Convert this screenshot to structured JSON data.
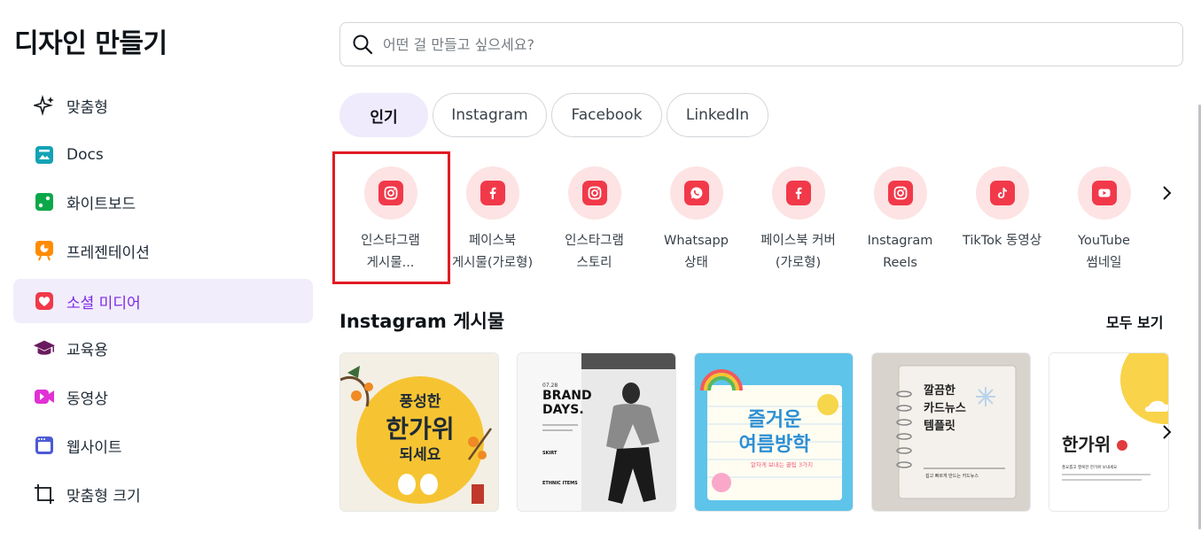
{
  "sidebar": {
    "title": "디자인 만들기",
    "items": [
      {
        "label": "맞춤형"
      },
      {
        "label": "Docs"
      },
      {
        "label": "화이트보드"
      },
      {
        "label": "프레젠테이션"
      },
      {
        "label": "소셜 미디어"
      },
      {
        "label": "교육용"
      },
      {
        "label": "동영상"
      },
      {
        "label": "웹사이트"
      },
      {
        "label": "맞춤형 크기"
      }
    ]
  },
  "search": {
    "placeholder": "어떤 걸 만들고 싶으세요?",
    "value": ""
  },
  "tabs": [
    {
      "label": "인기"
    },
    {
      "label": "Instagram"
    },
    {
      "label": "Facebook"
    },
    {
      "label": "LinkedIn"
    }
  ],
  "categories": [
    {
      "label": "인스타그램\n게시물...",
      "icon": "instagram-icon"
    },
    {
      "label": "페이스북\n게시물(가로형)",
      "icon": "facebook-icon"
    },
    {
      "label": "인스타그램\n스토리",
      "icon": "instagram-icon"
    },
    {
      "label": "Whatsapp\n상태",
      "icon": "whatsapp-icon"
    },
    {
      "label": "페이스북 커버\n(가로형)",
      "icon": "facebook-icon"
    },
    {
      "label": "Instagram\nReels",
      "icon": "instagram-icon"
    },
    {
      "label": "TikTok 동영상",
      "icon": "tiktok-icon"
    },
    {
      "label": "YouTube\n썸네일",
      "icon": "youtube-icon"
    }
  ],
  "section": {
    "title": "Instagram 게시물",
    "see_all": "모두 보기"
  },
  "templates": {
    "t1": {
      "line1": "풍성한",
      "line2": "한가위",
      "line3": "되세요"
    },
    "t2": {
      "title": "BRAND\nDAYS.",
      "date": "07.28",
      "skirt": "SKIRT",
      "ethnic": "ETHNIC ITEMS"
    },
    "t3": {
      "line1": "즐거운",
      "line2": "여름방학",
      "sub": "알차게 보내는 꿀팁 3가지"
    },
    "t4": {
      "line1": "깔끔한",
      "line2": "카드뉴스",
      "line3": "템플릿",
      "footer": "쉽고 빠르게 만드는 카드뉴스"
    },
    "t5": {
      "title": "한가위",
      "body": "풍요롭고 행복한 한가위 보내세요"
    }
  },
  "colors": {
    "accent": "#7d2ae8",
    "brand_red": "#f1394a",
    "highlight": "#e01b24"
  }
}
